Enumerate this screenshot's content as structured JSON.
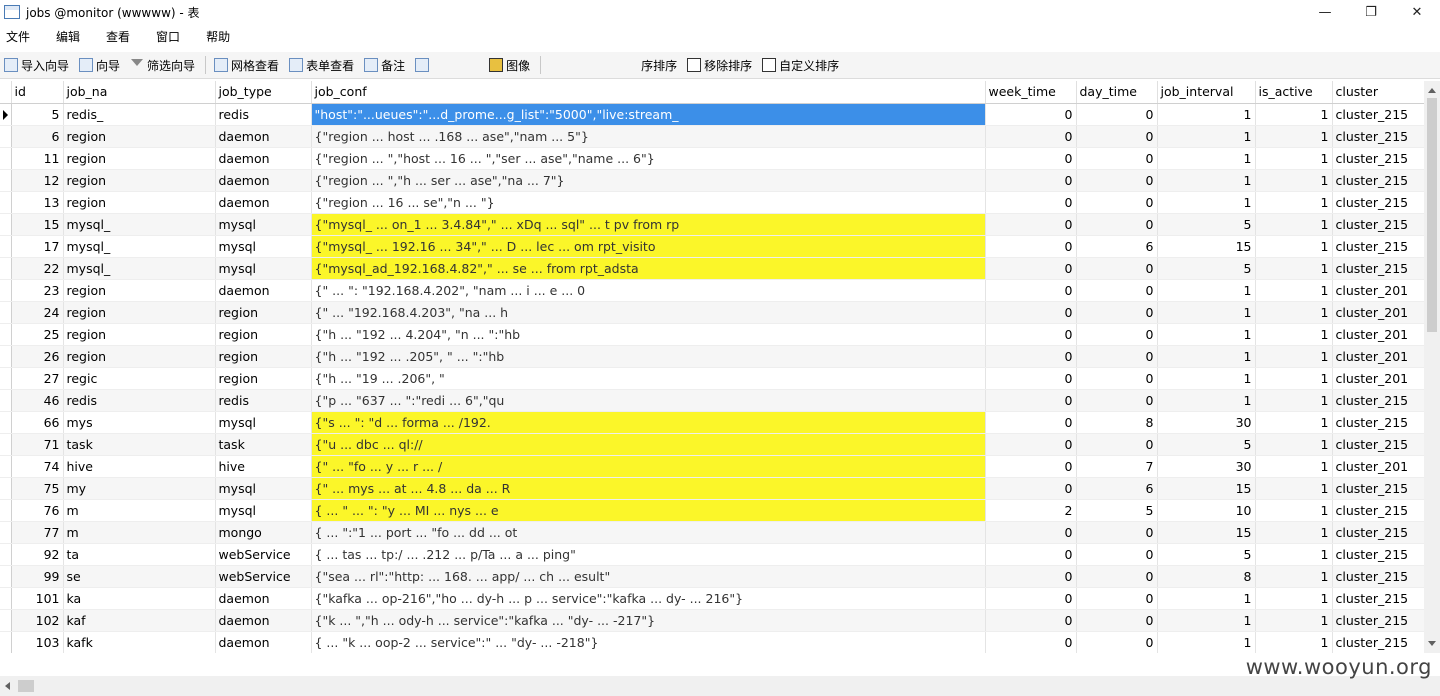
{
  "window": {
    "title": "jobs @monitor (wwwww) - 表",
    "minimize": "—",
    "maximize": "❐",
    "close": "✕"
  },
  "menu": [
    "文件",
    "编辑",
    "查看",
    "窗口",
    "帮助"
  ],
  "toolbar": {
    "import_wizard": "导入向导",
    "export_wizard": "向导",
    "filter_wizard": "筛选向导",
    "grid_view": "网格查看",
    "form_view": "表单查看",
    "memo": "备注",
    "image": "图像",
    "sort": "序排序",
    "remove_sort": "移除排序",
    "custom_sort": "自定义排序"
  },
  "columns": [
    "id",
    "job_na",
    "job_type",
    "job_conf",
    "week_time",
    "day_time",
    "job_interval",
    "is_active",
    "cluster"
  ],
  "rows": [
    {
      "id": "5",
      "name": "redis_",
      "type": "redis",
      "conf": "\"host\":\"...ueues\":\"...d_prome...g_list\":\"5000\",\"live:stream_",
      "week": "0",
      "day": "0",
      "interval": "1",
      "active": "1",
      "cluster": "cluster_215"
    },
    {
      "id": "6",
      "name": "region",
      "type": "daemon",
      "conf": "{\"region ... host ... .168 ... ase\",\"nam ... 5\"}",
      "week": "0",
      "day": "0",
      "interval": "1",
      "active": "1",
      "cluster": "cluster_215"
    },
    {
      "id": "11",
      "name": "region",
      "type": "daemon",
      "conf": "{\"region ... \",\"host ... 16 ... \",\"ser ... ase\",\"name ... 6\"}",
      "week": "0",
      "day": "0",
      "interval": "1",
      "active": "1",
      "cluster": "cluster_215"
    },
    {
      "id": "12",
      "name": "region",
      "type": "daemon",
      "conf": "{\"region ... \",\"h ... ser ... ase\",\"na ... 7\"}",
      "week": "0",
      "day": "0",
      "interval": "1",
      "active": "1",
      "cluster": "cluster_215"
    },
    {
      "id": "13",
      "name": "region",
      "type": "daemon",
      "conf": "{\"region ... 16 ... se\",\"n ... \"}",
      "week": "0",
      "day": "0",
      "interval": "1",
      "active": "1",
      "cluster": "cluster_215"
    },
    {
      "id": "15",
      "name": "mysql_",
      "type": "mysql",
      "conf": "{\"mysql_ ... on_1 ... 3.4.84\",\" ... xDq ... sql\" ... t pv from rp",
      "week": "0",
      "day": "0",
      "interval": "5",
      "active": "1",
      "cluster": "cluster_215"
    },
    {
      "id": "17",
      "name": "mysql_",
      "type": "mysql",
      "conf": "{\"mysql_ ... 192.16 ... 34\",\" ... D ... lec ... om rpt_visito",
      "week": "0",
      "day": "6",
      "interval": "15",
      "active": "1",
      "cluster": "cluster_215"
    },
    {
      "id": "22",
      "name": "mysql_",
      "type": "mysql",
      "conf": "{\"mysql_ad_192.168.4.82\",\" ... se ... from rpt_adsta",
      "week": "0",
      "day": "0",
      "interval": "5",
      "active": "1",
      "cluster": "cluster_215"
    },
    {
      "id": "23",
      "name": "region",
      "type": "daemon",
      "conf": "{\" ... \": \"192.168.4.202\", \"nam ... i ... e ... 0",
      "week": "0",
      "day": "0",
      "interval": "1",
      "active": "1",
      "cluster": "cluster_201"
    },
    {
      "id": "24",
      "name": "region",
      "type": "region",
      "conf": "{\" ... \"192.168.4.203\", \"na ... h",
      "week": "0",
      "day": "0",
      "interval": "1",
      "active": "1",
      "cluster": "cluster_201"
    },
    {
      "id": "25",
      "name": "region",
      "type": "region",
      "conf": "{\"h ... \"192 ... 4.204\", \"n ... \":\"hb",
      "week": "0",
      "day": "0",
      "interval": "1",
      "active": "1",
      "cluster": "cluster_201"
    },
    {
      "id": "26",
      "name": "region",
      "type": "region",
      "conf": "{\"h ... \"192 ... .205\", \" ... \":\"hb",
      "week": "0",
      "day": "0",
      "interval": "1",
      "active": "1",
      "cluster": "cluster_201"
    },
    {
      "id": "27",
      "name": "regic",
      "type": "region",
      "conf": "{\"h ... \"19 ... .206\", \"",
      "week": "0",
      "day": "0",
      "interval": "1",
      "active": "1",
      "cluster": "cluster_201"
    },
    {
      "id": "46",
      "name": "redis",
      "type": "redis",
      "conf": "{\"p ... \"637 ... \":\"redi ... 6\",\"qu",
      "week": "0",
      "day": "0",
      "interval": "1",
      "active": "1",
      "cluster": "cluster_215"
    },
    {
      "id": "66",
      "name": "mys",
      "type": "mysql",
      "conf": "{\"s ... \": \"d ... forma ... /192.",
      "week": "0",
      "day": "8",
      "interval": "30",
      "active": "1",
      "cluster": "cluster_215"
    },
    {
      "id": "71",
      "name": "task",
      "type": "task",
      "conf": "{\"u ... dbc ... ql://",
      "week": "0",
      "day": "0",
      "interval": "5",
      "active": "1",
      "cluster": "cluster_215"
    },
    {
      "id": "74",
      "name": "hive",
      "type": "hive",
      "conf": "{\" ... \"fo ... y ... r ... /",
      "week": "0",
      "day": "7",
      "interval": "30",
      "active": "1",
      "cluster": "cluster_201"
    },
    {
      "id": "75",
      "name": "my",
      "type": "mysql",
      "conf": "{\" ... mys ... at ... 4.8 ... da ... R",
      "week": "0",
      "day": "6",
      "interval": "15",
      "active": "1",
      "cluster": "cluster_215"
    },
    {
      "id": "76",
      "name": "m",
      "type": "mysql",
      "conf": "{ ... \" ... \": \"y ... MI ... nys ... e",
      "week": "2",
      "day": "5",
      "interval": "10",
      "active": "1",
      "cluster": "cluster_215"
    },
    {
      "id": "77",
      "name": "m",
      "type": "mongo",
      "conf": "{ ... \":\"1 ... port ... \"fo ... dd ... ot",
      "week": "0",
      "day": "0",
      "interval": "15",
      "active": "1",
      "cluster": "cluster_215"
    },
    {
      "id": "92",
      "name": "ta",
      "type": "webService",
      "conf": "{ ... tas ... tp:/ ... .212 ... p/Ta ... a ... ping\"",
      "week": "0",
      "day": "0",
      "interval": "5",
      "active": "1",
      "cluster": "cluster_215"
    },
    {
      "id": "99",
      "name": "se",
      "type": "webService",
      "conf": "{\"sea ... rl\":\"http: ... 168. ... app/ ... ch ... esult\"",
      "week": "0",
      "day": "0",
      "interval": "8",
      "active": "1",
      "cluster": "cluster_215"
    },
    {
      "id": "101",
      "name": "ka",
      "type": "daemon",
      "conf": "{\"kafka ... op-216\",\"ho ... dy-h ... p ... service\":\"kafka ... dy- ... 216\"}",
      "week": "0",
      "day": "0",
      "interval": "1",
      "active": "1",
      "cluster": "cluster_215"
    },
    {
      "id": "102",
      "name": "kaf",
      "type": "daemon",
      "conf": "{\"k ... \",\"h ... ody-h ... service\":\"kafka ... \"dy- ... -217\"}",
      "week": "0",
      "day": "0",
      "interval": "1",
      "active": "1",
      "cluster": "cluster_215"
    },
    {
      "id": "103",
      "name": "kafk",
      "type": "daemon",
      "conf": "{ ... \"k ... oop-2 ... service\":\" ... \"dy- ... -218\"}",
      "week": "0",
      "day": "0",
      "interval": "1",
      "active": "1",
      "cluster": "cluster_215"
    }
  ],
  "highlighted_ids": [
    "15",
    "17",
    "22",
    "66",
    "71",
    "74",
    "75",
    "76"
  ],
  "selected_id": "5",
  "watermark": "www.wooyun.org"
}
